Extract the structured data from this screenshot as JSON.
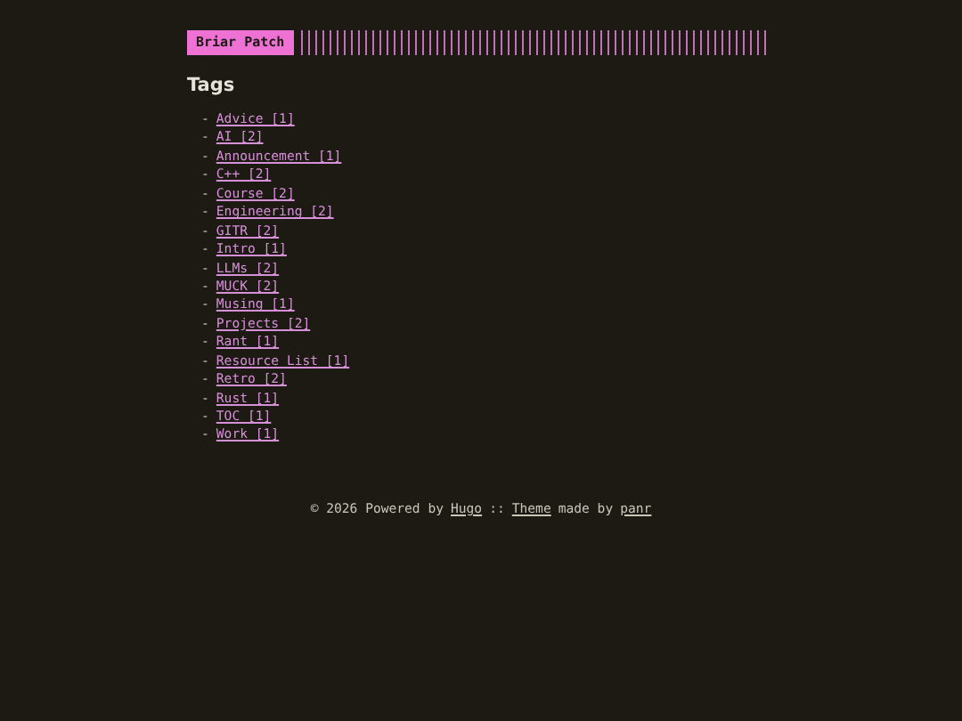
{
  "logo": "Briar Patch",
  "heading": "Tags",
  "tags": [
    {
      "bullet": "-",
      "label": "Advice [1]"
    },
    {
      "bullet": "-",
      "label": "AI [2]"
    },
    {
      "bullet": "-",
      "label": "Announcement [1]"
    },
    {
      "bullet": "-",
      "label": "C++ [2]"
    },
    {
      "bullet": "-",
      "label": "Course [2]"
    },
    {
      "bullet": "-",
      "label": "Engineering [2]"
    },
    {
      "bullet": "-",
      "label": "GITR [2]"
    },
    {
      "bullet": "-",
      "label": "Intro [1]"
    },
    {
      "bullet": "-",
      "label": "LLMs [2]"
    },
    {
      "bullet": "-",
      "label": "MUCK [2]"
    },
    {
      "bullet": "-",
      "label": "Musing [1]"
    },
    {
      "bullet": "-",
      "label": "Projects [2]"
    },
    {
      "bullet": "-",
      "label": "Rant [1]"
    },
    {
      "bullet": "-",
      "label": "Resource List [1]"
    },
    {
      "bullet": "-",
      "label": "Retro [2]"
    },
    {
      "bullet": "-",
      "label": "Rust [1]"
    },
    {
      "bullet": "-",
      "label": "TOC [1]"
    },
    {
      "bullet": "-",
      "label": "Work [1]"
    }
  ],
  "footer": [
    {
      "kind": "text",
      "text": "© 2026 Powered by"
    },
    {
      "kind": "link",
      "text": "Hugo"
    },
    {
      "kind": "text",
      "text": "::"
    },
    {
      "kind": "link",
      "text": "Theme"
    },
    {
      "kind": "text",
      "text": "made by"
    },
    {
      "kind": "link",
      "text": "panr"
    }
  ]
}
